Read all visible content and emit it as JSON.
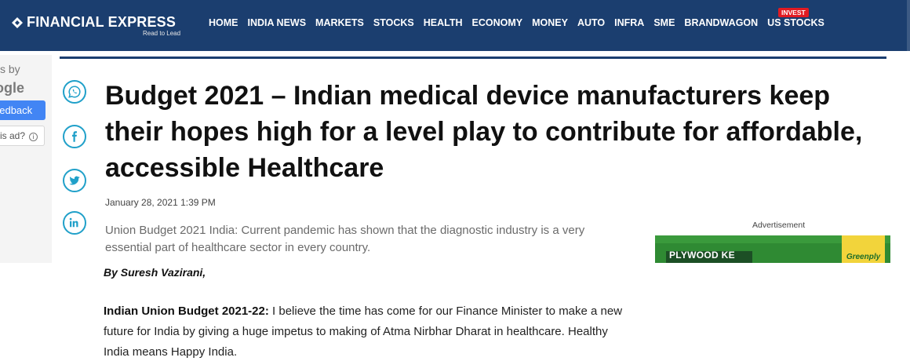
{
  "header": {
    "logo_text": "FINANCIAL EXPRESS",
    "tagline": "Read to Lead",
    "nav": [
      "HOME",
      "INDIA NEWS",
      "MARKETS",
      "STOCKS",
      "HEALTH",
      "ECONOMY",
      "MONEY",
      "AUTO",
      "INFRA",
      "SME",
      "BRANDWAGON",
      "US STOCKS"
    ],
    "badge": "INVEST",
    "bg_color": "#1b3e6f"
  },
  "left_ad": {
    "ads_by": "s by",
    "google": "ogle",
    "feedback": "eedback",
    "why_ad": "is ad?",
    "info_glyph": "i"
  },
  "share_icons": [
    "whatsapp-icon",
    "facebook-icon",
    "twitter-icon",
    "linkedin-icon"
  ],
  "article": {
    "headline": "Budget 2021 – Indian medical device manufacturers keep their hopes high for a level play to contribute for affordable, accessible Healthcare",
    "date": "January 28, 2021 1:39 PM",
    "summary": "Union Budget 2021 India: Current pandemic has shown that the diagnostic industry is a very essential part of healthcare sector in every country.",
    "byline": "By Suresh Vazirani,",
    "lead_bold": "Indian Union Budget 2021-22:",
    "lead_text": " I believe the time has come for our Finance Minister to make a new future for India by giving a huge impetus to making of Atma Nirbhar Dharat in healthcare. Healthy India means Happy India."
  },
  "right_ad": {
    "label": "Advertisement",
    "text": "PLYWOOD KE",
    "brand": "Greenply"
  }
}
